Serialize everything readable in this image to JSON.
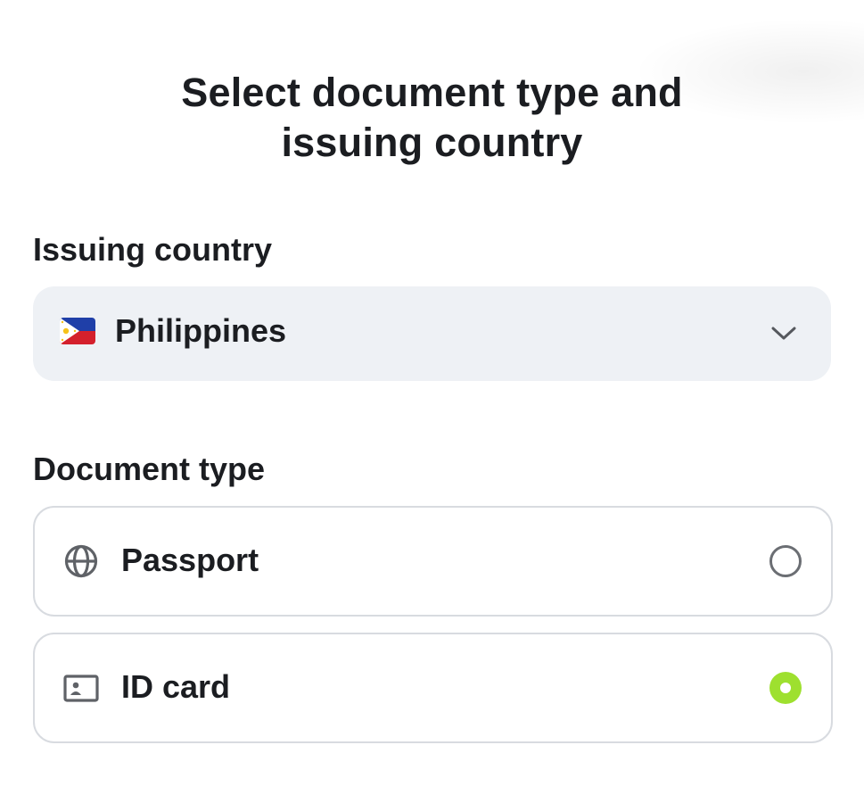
{
  "header": {
    "title_line1": "Select document type and",
    "title_line2": "issuing country"
  },
  "issuing_country": {
    "label": "Issuing country",
    "selected": "Philippines",
    "flag_icon": "philippines-flag-icon",
    "expand_icon": "chevron-down-icon"
  },
  "document_type": {
    "label": "Document type",
    "options": [
      {
        "label": "Passport",
        "icon": "globe-icon",
        "selected": false
      },
      {
        "label": "ID card",
        "icon": "id-card-icon",
        "selected": true
      }
    ]
  },
  "colors": {
    "accent_selected": "#9ee02f",
    "select_background": "#eef1f5",
    "border": "#d8dbe0",
    "text": "#1b1d21"
  }
}
